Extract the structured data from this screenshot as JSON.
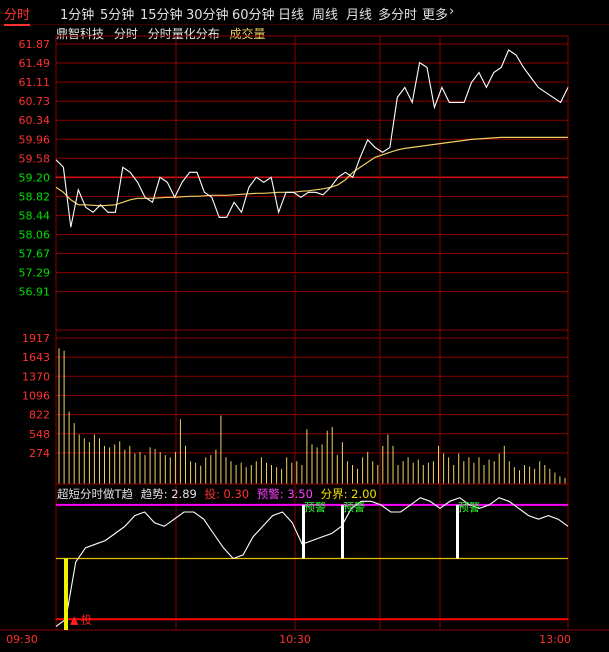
{
  "toolbar": {
    "tabs": [
      {
        "label": "分时",
        "active": true
      },
      {
        "label": "1分钟"
      },
      {
        "label": "5分钟"
      },
      {
        "label": "15分钟"
      },
      {
        "label": "30分钟"
      },
      {
        "label": "60分钟"
      },
      {
        "label": "日线"
      },
      {
        "label": "周线"
      },
      {
        "label": "月线"
      },
      {
        "label": "多分时"
      },
      {
        "label": "更多"
      }
    ]
  },
  "header": {
    "stock_name": "鼎智科技",
    "mode": "分时",
    "dist": "分时量化分布",
    "volume": "成交量"
  },
  "price_axis": [
    "61.87",
    "61.49",
    "61.11",
    "60.73",
    "60.34",
    "59.96",
    "59.58",
    "59.20",
    "58.82",
    "58.44",
    "58.06",
    "57.67",
    "57.29",
    "56.91"
  ],
  "volume_axis": [
    "1917",
    "1643",
    "1370",
    "1096",
    "822",
    "548",
    "274"
  ],
  "indicator": {
    "title": "超短分时做T趋",
    "trend_label": "趋势:",
    "trend_value": "2.89",
    "buy_label": "投:",
    "buy_value": "0.30",
    "warn_label": "预警:",
    "warn_value": "3.50",
    "bound_label": "分界:",
    "bound_value": "2.00",
    "warn_tag": "预警",
    "buy_tag": "投"
  },
  "time_axis": [
    "09:30",
    "10:30",
    "13:00"
  ],
  "colors": {
    "up": "#ff3030",
    "down": "#00e000",
    "grid": "#8b0000",
    "avg": "#f0d060",
    "warn": "#ff00ff",
    "bound": "#e8c000",
    "buy": "#ff0000"
  },
  "chart_data": {
    "type": "line",
    "price": [
      59.55,
      59.4,
      58.2,
      58.95,
      58.6,
      58.5,
      58.65,
      58.5,
      58.5,
      59.4,
      59.3,
      59.1,
      58.8,
      58.7,
      59.2,
      59.1,
      58.8,
      59.1,
      59.3,
      59.3,
      58.9,
      58.8,
      58.4,
      58.4,
      58.7,
      58.5,
      59.0,
      59.2,
      59.1,
      59.2,
      58.5,
      58.9,
      58.9,
      58.8,
      58.9,
      58.9,
      58.85,
      59.0,
      59.2,
      59.3,
      59.2,
      59.6,
      59.95,
      59.8,
      59.7,
      59.8,
      60.8,
      61.0,
      60.7,
      61.5,
      61.4,
      60.6,
      61.0,
      60.7,
      60.7,
      60.7,
      61.1,
      61.3,
      61.0,
      61.3,
      61.4,
      61.75,
      61.65,
      61.4,
      61.2,
      61.0,
      60.9,
      60.8,
      60.7,
      61.0
    ],
    "avg_price": [
      59.0,
      58.9,
      58.75,
      58.65,
      58.65,
      58.64,
      58.63,
      58.64,
      58.65,
      58.7,
      58.75,
      58.78,
      58.78,
      58.78,
      58.79,
      58.8,
      58.8,
      58.81,
      58.82,
      58.82,
      58.83,
      58.84,
      58.84,
      58.84,
      58.85,
      58.86,
      58.87,
      58.88,
      58.88,
      58.89,
      58.9,
      58.9,
      58.9,
      58.92,
      58.93,
      58.95,
      58.97,
      59.0,
      59.05,
      59.15,
      59.3,
      59.4,
      59.5,
      59.6,
      59.65,
      59.7,
      59.75,
      59.78,
      59.8,
      59.82,
      59.84,
      59.86,
      59.88,
      59.9,
      59.92,
      59.94,
      59.96,
      59.97,
      59.98,
      59.99,
      60.0,
      60.0,
      60.0,
      60.0,
      60.0,
      60.0,
      60.0,
      60.0,
      60.0,
      60.0
    ],
    "volume": [
      1780,
      1750,
      950,
      800,
      650,
      600,
      550,
      650,
      600,
      500,
      480,
      520,
      560,
      450,
      500,
      400,
      420,
      380,
      480,
      460,
      420,
      380,
      350,
      420,
      850,
      500,
      300,
      280,
      240,
      350,
      380,
      450,
      900,
      350,
      300,
      250,
      280,
      220,
      250,
      300,
      350,
      280,
      250,
      220,
      200,
      350,
      280,
      300,
      250,
      720,
      520,
      480,
      520,
      700,
      750,
      380,
      550,
      300,
      250,
      200,
      350,
      420,
      300,
      250,
      500,
      650,
      500,
      250,
      300,
      350,
      280,
      320,
      250,
      280,
      300,
      500,
      400,
      350,
      250,
      400,
      300,
      350,
      280,
      350,
      250,
      320,
      300,
      400,
      500,
      300,
      220,
      180,
      250,
      230,
      200,
      300,
      250,
      200,
      150,
      100,
      80
    ],
    "trend": [
      0.1,
      0.3,
      1.9,
      2.3,
      2.4,
      2.5,
      2.7,
      2.9,
      3.2,
      3.3,
      3.0,
      2.9,
      3.1,
      3.3,
      3.3,
      3.1,
      2.7,
      2.3,
      2.0,
      2.1,
      2.6,
      2.9,
      3.2,
      3.3,
      3.0,
      2.4,
      2.5,
      2.6,
      2.7,
      2.9,
      3.4,
      3.6,
      3.6,
      3.5,
      3.3,
      3.3,
      3.5,
      3.7,
      3.6,
      3.4,
      3.6,
      3.7,
      3.5,
      3.4,
      3.5,
      3.7,
      3.6,
      3.4,
      3.2,
      3.1,
      3.2,
      3.1,
      2.9
    ],
    "warn_level": 3.5,
    "bound_level": 2.0,
    "buy_level": 0.3,
    "y_range": [
      0,
      4
    ]
  }
}
